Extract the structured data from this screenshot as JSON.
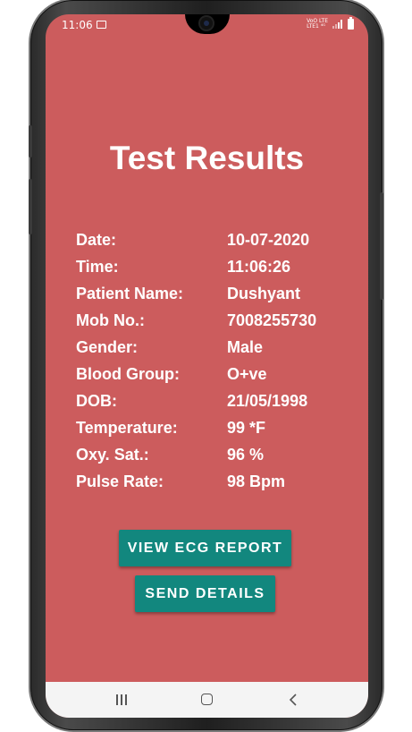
{
  "status_bar": {
    "time": "11:06",
    "network_top": "VoO LTE",
    "network_bottom": "LTE1 ⁴ᴳ"
  },
  "page": {
    "title": "Test Results"
  },
  "details": [
    {
      "label": "Date:",
      "value": "10-07-2020"
    },
    {
      "label": "Time:",
      "value": "11:06:26"
    },
    {
      "label": "Patient Name:",
      "value": "Dushyant"
    },
    {
      "label": "Mob No.:",
      "value": "7008255730"
    },
    {
      "label": "Gender:",
      "value": "Male"
    },
    {
      "label": "Blood Group:",
      "value": "O+ve"
    },
    {
      "label": "DOB:",
      "value": "21/05/1998"
    },
    {
      "label": "Temperature:",
      "value": "99 *F"
    },
    {
      "label": "Oxy. Sat.:",
      "value": "96 %"
    },
    {
      "label": "Pulse Rate:",
      "value": "98 Bpm"
    }
  ],
  "buttons": {
    "view_ecg": "VIEW ECG REPORT",
    "send_details": "SEND DETAILS"
  },
  "colors": {
    "background": "#cc5c5d",
    "button": "#12877e",
    "text": "#ffffff"
  }
}
